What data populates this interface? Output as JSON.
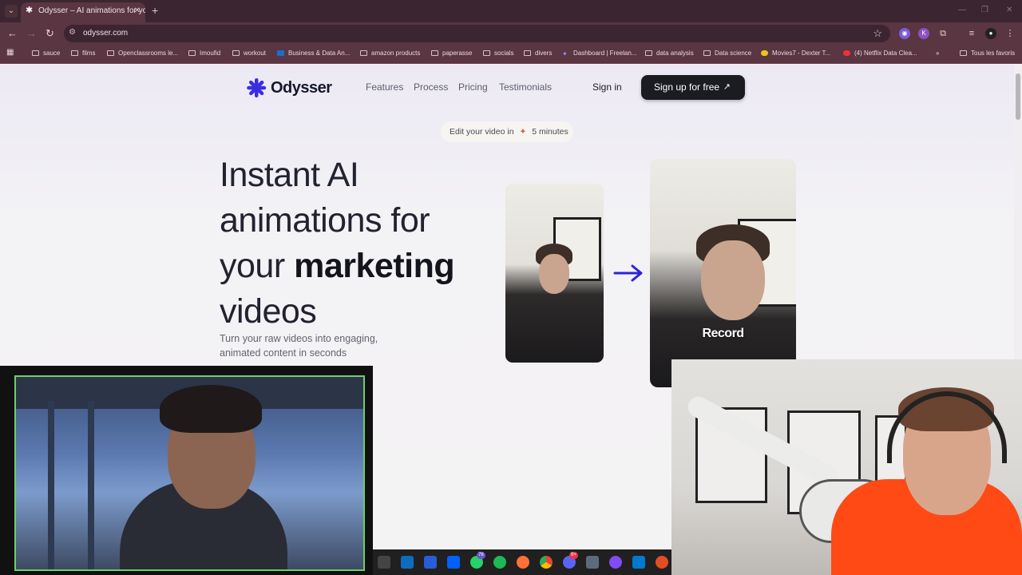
{
  "browser": {
    "tab_title": "Odysser – AI animations for yo",
    "url": "odysser.com",
    "bookmarks": [
      "sauce",
      "films",
      "Openclassrooms le...",
      "Imoufid",
      "workout",
      "Business & Data An...",
      "amazon products",
      "paperasse",
      "socials",
      "divers",
      "Dashboard | Freelan...",
      "data analysis",
      "Data science",
      "Movies7 - Dexter T...",
      "(4) Netflix Data Clea...",
      "Tous les favoris"
    ]
  },
  "header": {
    "logo_text": "Odysser",
    "nav": [
      "Features",
      "Process",
      "Pricing",
      "Testimonials"
    ],
    "sign_in": "Sign in",
    "sign_up": "Sign up for free"
  },
  "hero": {
    "pill_prefix": "Edit your video in",
    "pill_suffix": "5 minutes",
    "title_line1": "Instant AI",
    "title_line2": "animations for",
    "title_line3_a": "your",
    "title_line3_b": "marketing",
    "title_line4": "videos",
    "subtitle": "Turn your raw videos into engaging, animated content in seconds",
    "record_label": "Record"
  },
  "taskbar": {
    "whatsapp_badge": "76",
    "discord_badge": "9+"
  },
  "colors": {
    "accent_arrow": "#2d23d9",
    "logo_mark": "#3a2ee0",
    "browser_frame": "#5a3542"
  }
}
